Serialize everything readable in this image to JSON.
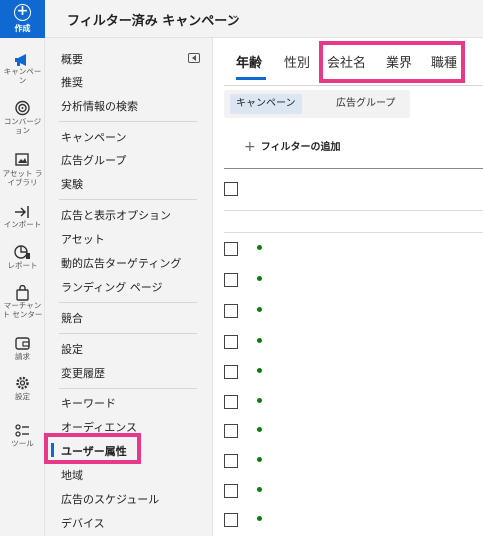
{
  "rail": {
    "create_label": "作成",
    "items": [
      {
        "label": "キャンペー\nン",
        "icon": "megaphone-icon"
      },
      {
        "label": "コンバージ\nョン",
        "icon": "target-icon"
      },
      {
        "label": "アセット ラ\nイブラリ",
        "icon": "asset-library-icon"
      },
      {
        "label": "インポート",
        "icon": "import-icon"
      },
      {
        "label": "レポート",
        "icon": "report-icon"
      },
      {
        "label": "マーチャン\nト センター",
        "icon": "shopping-bag-icon"
      },
      {
        "label": "請求",
        "icon": "wallet-icon"
      },
      {
        "label": "設定",
        "icon": "gear-icon"
      },
      {
        "label": "ツール",
        "icon": "tools-icon"
      }
    ]
  },
  "header": {
    "title": "フィルター済み キャンペーン",
    "chevron": "chevron-down-icon"
  },
  "nav": {
    "items": [
      "概要",
      "推奨",
      "分析情報の検索",
      "キャンペーン",
      "広告グループ",
      "実験",
      "広告と表示オプション",
      "アセット",
      "動的広告ターゲティング",
      "ランディング ページ",
      "競合",
      "設定",
      "変更履歴",
      "キーワード",
      "オーディエンス",
      "ユーザー属性",
      "地域",
      "広告のスケジュール",
      "デバイス"
    ],
    "active": "ユーザー属性"
  },
  "main": {
    "tabs": [
      "年齢",
      "性別",
      "会社名",
      "業界",
      "職種"
    ],
    "active_tab": "年齢",
    "segments": [
      "キャンペーン",
      "広告グループ"
    ],
    "active_segment": "キャンペーン",
    "add_filter_label": "フィルターの追加",
    "status_color": "#107c10"
  },
  "colors": {
    "accent": "#1069d0",
    "highlight": "#e8388a"
  }
}
